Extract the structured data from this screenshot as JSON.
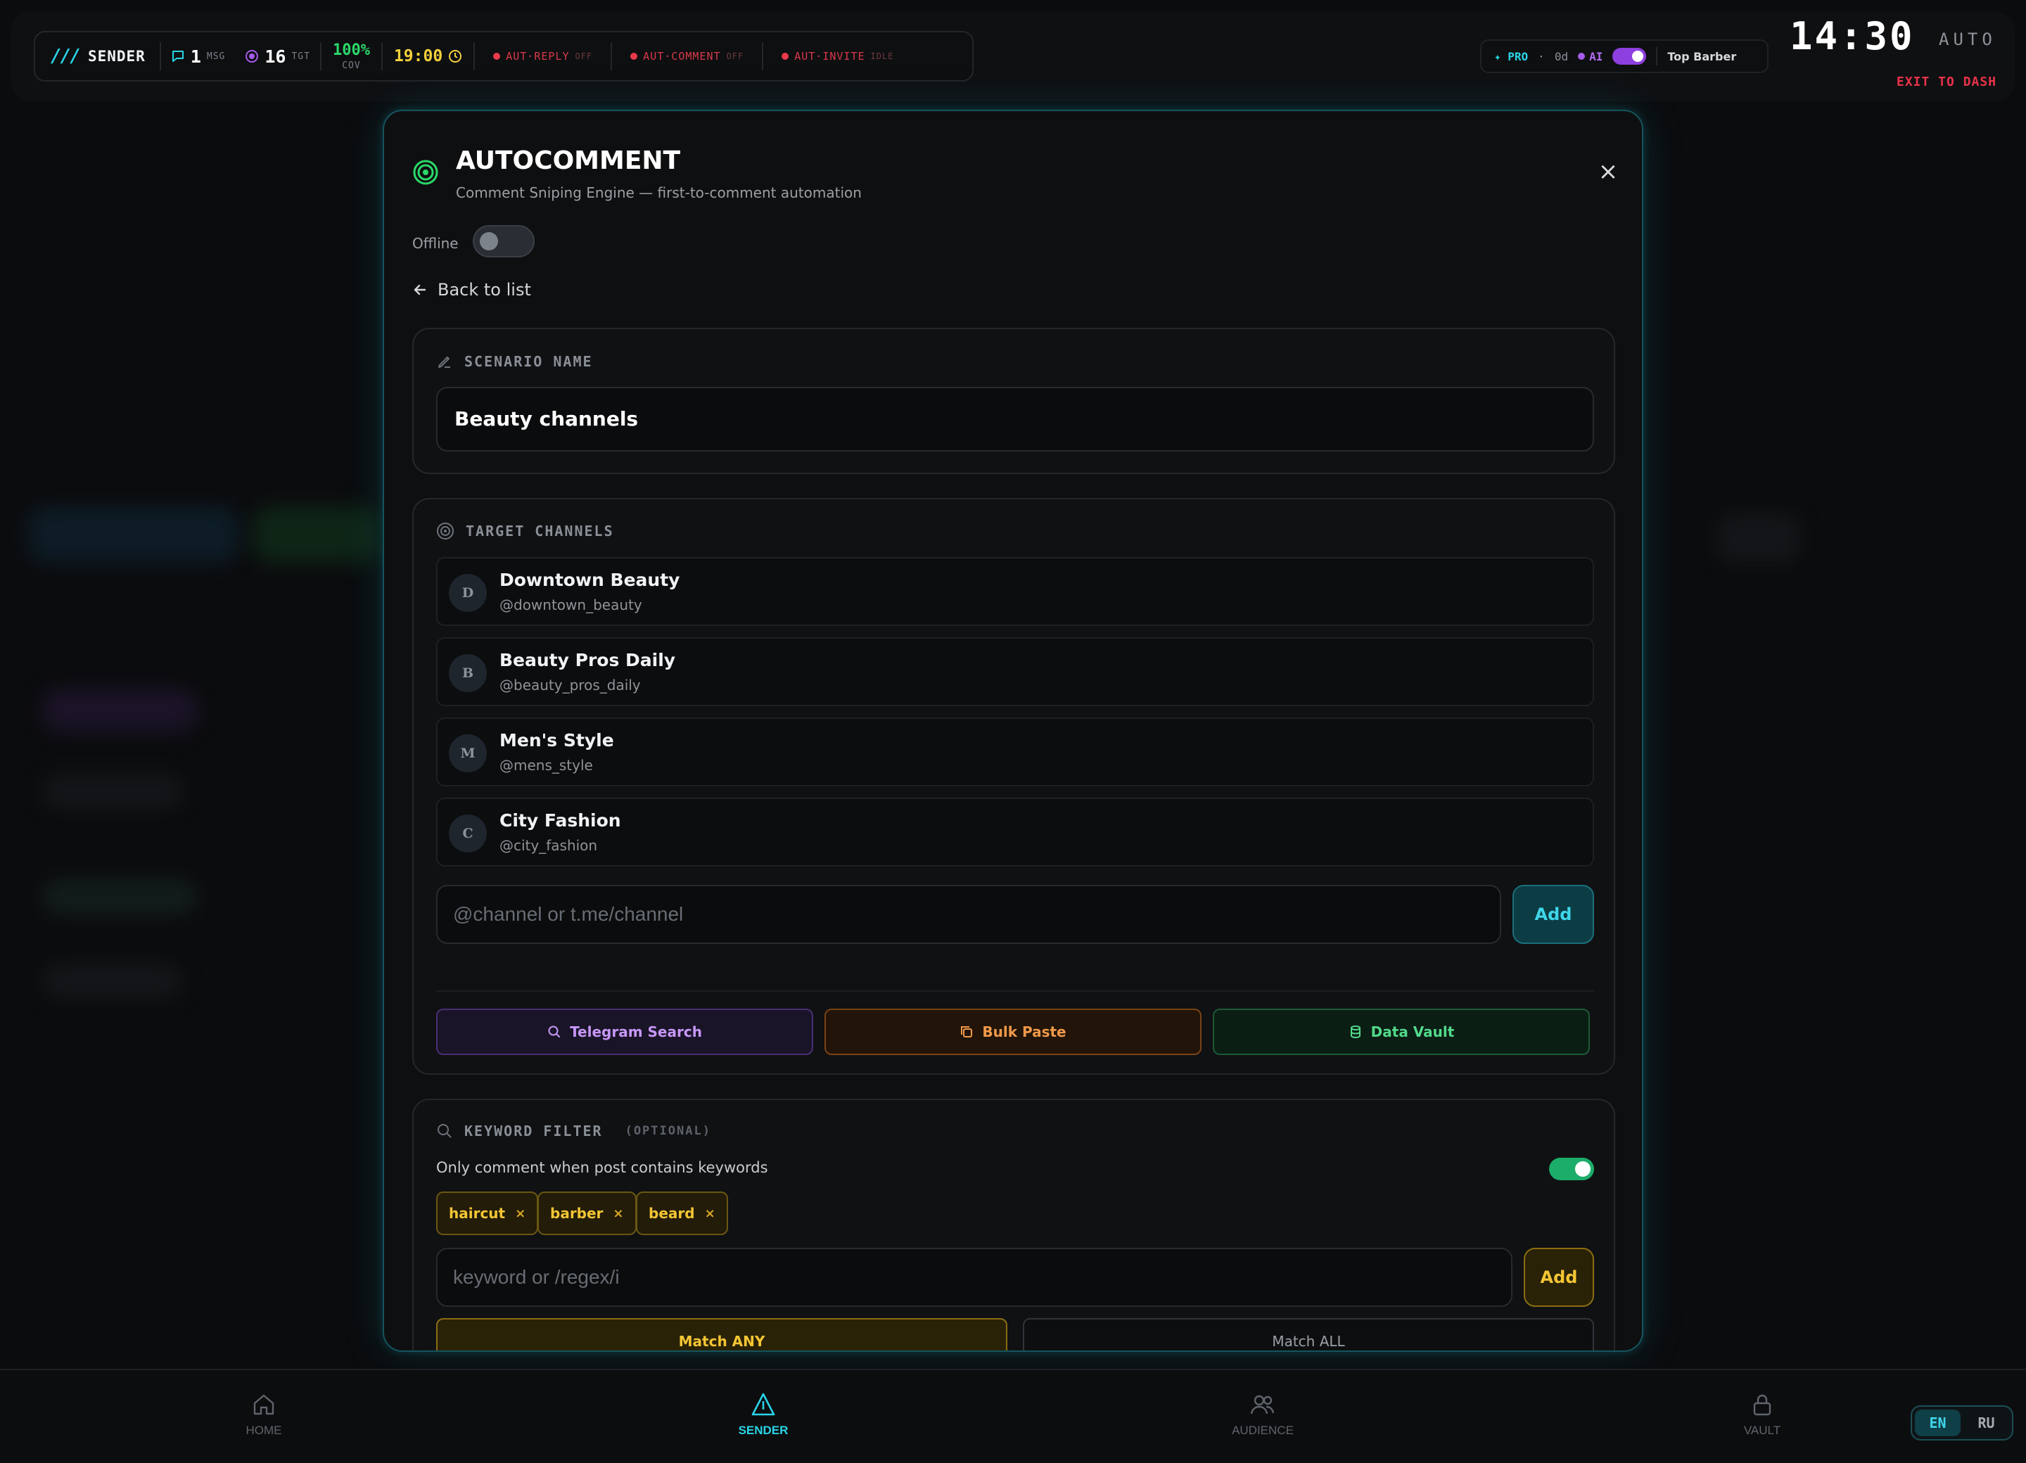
{
  "statusbar": {
    "brand_slash": "///",
    "brand_name": "SENDER",
    "msg_count": "1",
    "msg_label": "MSG",
    "tgt_count": "16",
    "tgt_label": "TGT",
    "coverage": "100%",
    "coverage_label": "COV",
    "time": "19:00",
    "auto_items": [
      {
        "label": "AUT·REPLY",
        "state": "OFF"
      },
      {
        "label": "AUT·COMMENT",
        "state": "OFF"
      },
      {
        "label": "AUT·INVITE",
        "state": "IDLE"
      }
    ]
  },
  "profile": {
    "plan": "✦ PRO",
    "dot": "·",
    "days": "0d",
    "ai_label": "AI",
    "ai_enabled": true,
    "business": "Top Barber"
  },
  "clock": {
    "time": "14:30",
    "mode": "AUTO",
    "exit": "EXIT TO DASH"
  },
  "modal": {
    "title": "AUTOCOMMENT",
    "subtitle": "Comment Sniping Engine — first-to-comment automation",
    "close_glyph": "×",
    "status_label": "Offline",
    "status_on": false,
    "back_label": "Back to list",
    "scenario": {
      "header": "SCENARIO NAME",
      "value": "Beauty channels"
    },
    "channels": {
      "header": "TARGET CHANNELS",
      "items": [
        {
          "initial": "D",
          "name": "Downtown Beauty",
          "handle": "@downtown_beauty"
        },
        {
          "initial": "B",
          "name": "Beauty Pros Daily",
          "handle": "@beauty_pros_daily"
        },
        {
          "initial": "M",
          "name": "Men's Style",
          "handle": "@mens_style"
        },
        {
          "initial": "C",
          "name": "City Fashion",
          "handle": "@city_fashion"
        }
      ],
      "input_placeholder": "@channel or t.me/channel",
      "add_label": "Add",
      "sources": {
        "telegram": "Telegram Search",
        "bulk": "Bulk Paste",
        "vault": "Data Vault"
      }
    },
    "keywords": {
      "header": "KEYWORD FILTER",
      "optional": "(OPTIONAL)",
      "description": "Only comment when post contains keywords",
      "enabled": true,
      "chips": [
        "haircut",
        "barber",
        "beard"
      ],
      "chip_remove": "×",
      "input_placeholder": "keyword or /regex/i",
      "add_label": "Add",
      "match_any": "Match ANY",
      "match_all": "Match ALL"
    }
  },
  "bottomnav": {
    "items": [
      {
        "label": "HOME",
        "icon": "home-icon"
      },
      {
        "label": "SENDER",
        "icon": "sender-icon"
      },
      {
        "label": "AUDIENCE",
        "icon": "audience-icon"
      },
      {
        "label": "VAULT",
        "icon": "lock-icon"
      }
    ],
    "active": "SENDER",
    "lang_active": "EN",
    "lang_other": "RU"
  },
  "colors": {
    "accent_cyan": "#2ad4e6",
    "success_green": "#2bd96a",
    "warning_amber": "#f4c534",
    "danger_red": "#e8334a",
    "ai_purple": "#a45be8"
  }
}
